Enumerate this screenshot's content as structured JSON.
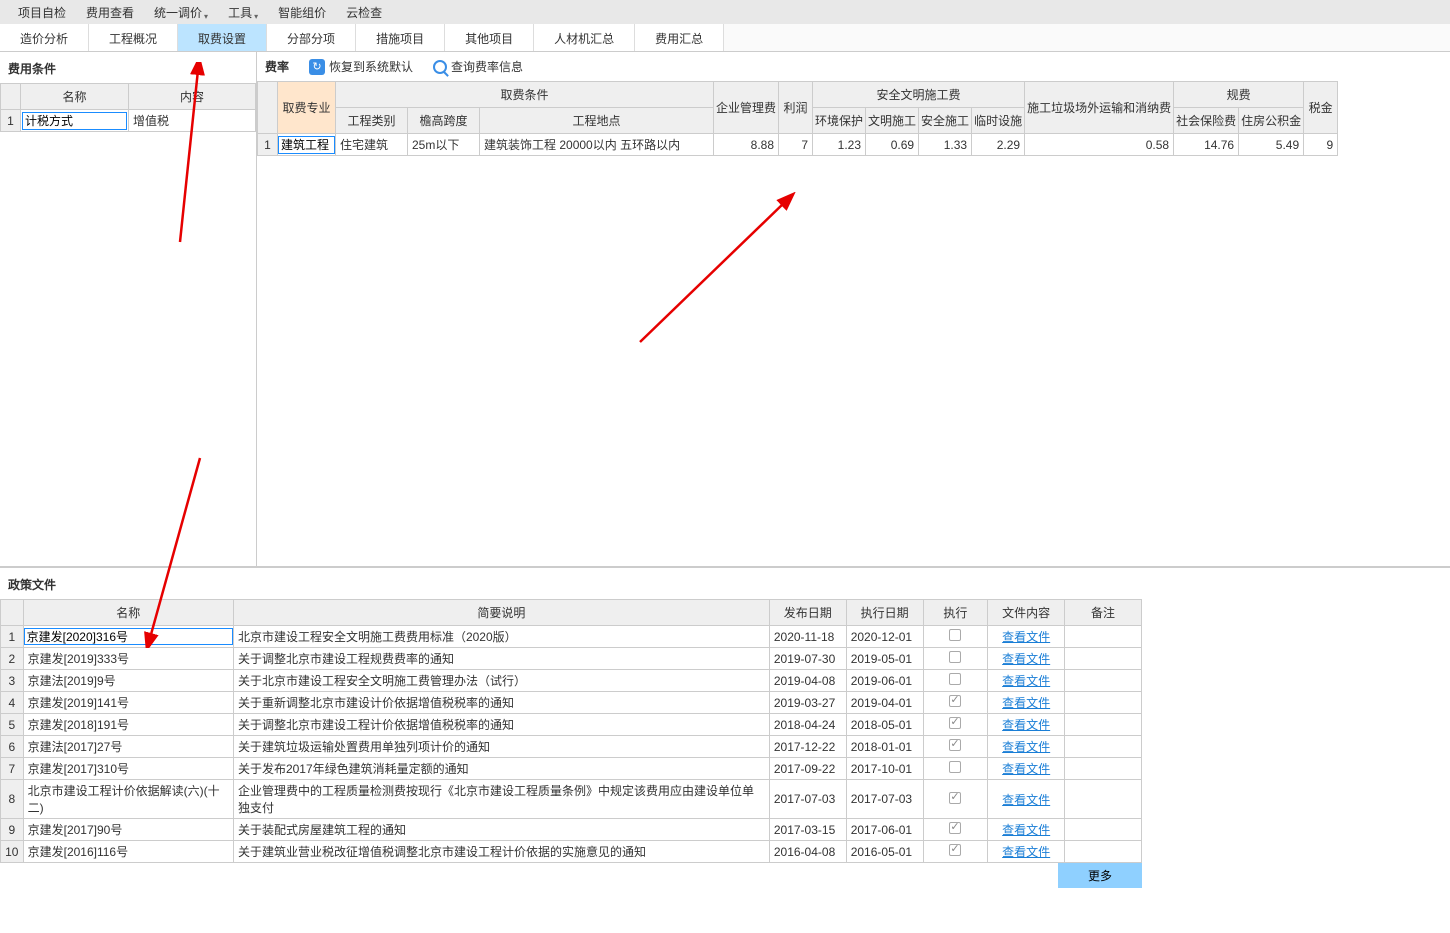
{
  "topMenu": [
    {
      "label": "项目自检",
      "dropdown": false
    },
    {
      "label": "费用查看",
      "dropdown": false
    },
    {
      "label": "统一调价",
      "dropdown": true
    },
    {
      "label": "工具",
      "dropdown": true
    },
    {
      "label": "智能组价",
      "dropdown": false
    },
    {
      "label": "云检查",
      "dropdown": false
    }
  ],
  "tabs": [
    "造价分析",
    "工程概况",
    "取费设置",
    "分部分项",
    "措施项目",
    "其他项目",
    "人材机汇总",
    "费用汇总"
  ],
  "activeTab": 2,
  "leftPanel": {
    "title": "费用条件",
    "headers": [
      "名称",
      "内容"
    ],
    "row": {
      "name": "计税方式",
      "content": "增值税"
    }
  },
  "rateToolbar": {
    "title": "费率",
    "reset": "恢复到系统默认",
    "query": "查询费率信息"
  },
  "rateTable": {
    "groupHeaders": {
      "major": "取费专业",
      "cond": "取费条件",
      "mgmt": "企业管理费",
      "profit": "利润",
      "safety": "安全文明施工费",
      "trash": "施工垃圾场外运输和消纳费",
      "guifei": "规费",
      "tax": "税金"
    },
    "subHeaders": {
      "type": "工程类别",
      "span": "檐高跨度",
      "loc": "工程地点",
      "env": "环境保护",
      "civil": "文明施工",
      "safe": "安全施工",
      "temp": "临时设施",
      "social": "社会保险费",
      "housing": "住房公积金"
    },
    "row": {
      "major": "建筑工程",
      "type": "住宅建筑",
      "span": "25m以下",
      "locA": "建筑装饰工程",
      "locB": "20000以内",
      "locC": "五环路以内",
      "mgmt": "8.88",
      "profit": "7",
      "env": "1.23",
      "civil": "0.69",
      "safe": "1.33",
      "temp": "2.29",
      "trash": "0.58",
      "social": "14.76",
      "housing": "5.49",
      "tax": "9"
    }
  },
  "policy": {
    "title": "政策文件",
    "headers": [
      "名称",
      "简要说明",
      "发布日期",
      "执行日期",
      "执行",
      "文件内容",
      "备注"
    ],
    "viewFile": "查看文件",
    "more": "更多",
    "rows": [
      {
        "name": "京建发[2020]316号",
        "desc": "北京市建设工程安全文明施工费费用标准（2020版）",
        "pub": "2020-11-18",
        "exec": "2020-12-01",
        "chk": false
      },
      {
        "name": "京建发[2019]333号",
        "desc": "关于调整北京市建设工程规费费率的通知",
        "pub": "2019-07-30",
        "exec": "2019-05-01",
        "chk": false
      },
      {
        "name": "京建法[2019]9号",
        "desc": "关于北京市建设工程安全文明施工费管理办法（试行）",
        "pub": "2019-04-08",
        "exec": "2019-06-01",
        "chk": false
      },
      {
        "name": "京建发[2019]141号",
        "desc": "关于重新调整北京市建设计价依据增值税税率的通知",
        "pub": "2019-03-27",
        "exec": "2019-04-01",
        "chk": true
      },
      {
        "name": "京建发[2018]191号",
        "desc": "关于调整北京市建设工程计价依据增值税税率的通知",
        "pub": "2018-04-24",
        "exec": "2018-05-01",
        "chk": true
      },
      {
        "name": "京建法[2017]27号",
        "desc": "关于建筑垃圾运输处置费用单独列项计价的通知",
        "pub": "2017-12-22",
        "exec": "2018-01-01",
        "chk": true
      },
      {
        "name": "京建发[2017]310号",
        "desc": "关于发布2017年绿色建筑消耗量定额的通知",
        "pub": "2017-09-22",
        "exec": "2017-10-01",
        "chk": false
      },
      {
        "name": "北京市建设工程计价依据解读(六)(十二)",
        "desc": "企业管理费中的工程质量检测费按现行《北京市建设工程质量条例》中规定该费用应由建设单位单独支付",
        "pub": "2017-07-03",
        "exec": "2017-07-03",
        "chk": true
      },
      {
        "name": "京建发[2017]90号",
        "desc": "关于装配式房屋建筑工程的通知",
        "pub": "2017-03-15",
        "exec": "2017-06-01",
        "chk": true
      },
      {
        "name": "京建发[2016]116号",
        "desc": "关于建筑业营业税改征增值税调整北京市建设工程计价依据的实施意见的通知",
        "pub": "2016-04-08",
        "exec": "2016-05-01",
        "chk": true
      }
    ]
  }
}
